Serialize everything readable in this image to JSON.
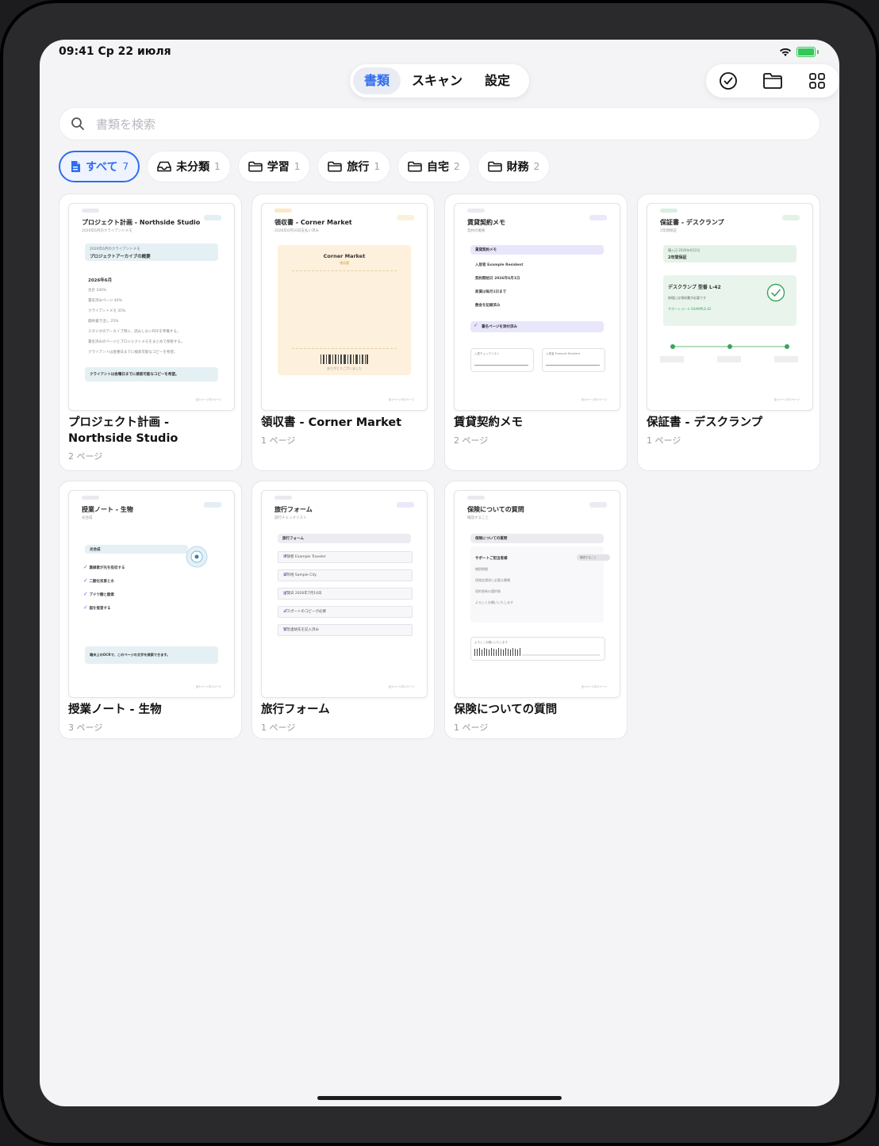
{
  "status_bar": {
    "time": "09:41",
    "date": "Ср 22 июля"
  },
  "segments": [
    {
      "label": "書類",
      "active": true
    },
    {
      "label": "スキャン",
      "active": false
    },
    {
      "label": "設定",
      "active": false
    }
  ],
  "toolbar": {
    "icons": [
      "checkmark-circle-icon",
      "folder-icon",
      "grid-icon"
    ]
  },
  "search": {
    "placeholder": "書類を検索"
  },
  "filters": [
    {
      "label": "すべて",
      "count": "7",
      "icon": "document-icon",
      "active": true
    },
    {
      "label": "未分類",
      "count": "1",
      "icon": "inbox-tray-icon",
      "active": false
    },
    {
      "label": "学習",
      "count": "1",
      "icon": "folder-icon",
      "active": false
    },
    {
      "label": "旅行",
      "count": "1",
      "icon": "folder-icon",
      "active": false
    },
    {
      "label": "自宅",
      "count": "2",
      "icon": "folder-icon",
      "active": false
    },
    {
      "label": "財務",
      "count": "2",
      "icon": "folder-icon",
      "active": false
    }
  ],
  "documents": [
    {
      "title": "プロジェクト計画 - Northside Studio",
      "pages": "2 ページ",
      "thumb": {
        "title": "プロジェクト計画 - Northside Studio",
        "sub": "2026年6月のクライアントメモ",
        "box_small": "2026年6月のクライアントメモ",
        "box_bold": "プロジェクトアーカイブの概要",
        "heading": "2026年6月",
        "lines": [
          "合計 100%",
          "署名済みページ 40%",
          "クライアントメモ 35%",
          "最終書き出し 25%",
          "スタジオのアーカイブ用に、読みしないPDFを準備する。",
          "署名済みのページとプロジェクトメモをまとめて保管する。",
          "クライアントは金曜日までに検索可能なコピーを希望。"
        ],
        "bottom_box": "クライアントは金曜日までに検索可能なコピーを希望。",
        "foot": "全2ページ中1ページ"
      }
    },
    {
      "title": "領収書 - Corner Market",
      "pages": "1 ページ",
      "thumb": {
        "title": "領収書 - Corner Market",
        "sub": "2026年6月10日支払い済み",
        "receipt_name": "Corner Market",
        "receipt_sub": "領収書",
        "receipt_thanks": "ありがとうございました",
        "foot": "全1ページ中1ページ"
      }
    },
    {
      "title": "賃貸契約メモ",
      "pages": "2 ページ",
      "thumb": {
        "title": "賃貸契約メモ",
        "sub": "契約の概要",
        "header_row": "賃貸契約メモ",
        "rows": [
          "入居者 Example Resident",
          "契約開始日 2026年6月1日",
          "家賃は毎月1日まで",
          "敷金を記録済み"
        ],
        "check_row": "署名ページを添付済み",
        "sig_left": "入居チェックリスト",
        "sig_right": "入居者 Example Resident",
        "foot": "全2ページ中1ページ"
      }
    },
    {
      "title": "保証書 - デスクランプ",
      "pages": "1 ページ",
      "thumb": {
        "title": "保証書 - デスクランプ",
        "sub": "2年間保証",
        "box_small": "購入日 2026年6月2日",
        "box_bold": "2年間保証",
        "card_title": "デスクランプ 型番 L-42",
        "card_line": "修理には領収書が必要です",
        "card_code": "サポートコード EXAMPLE-42",
        "foot": "全1ページ中1ページ"
      }
    },
    {
      "title": "授業ノート - 生物",
      "pages": "3 ページ",
      "thumb": {
        "title": "授業ノート - 生物",
        "sub": "光合成",
        "header_row": "光合成",
        "items": [
          "葉緑素が光を吸収する",
          "二酸化炭素と水",
          "ブドウ糖と酸素",
          "図を復習する"
        ],
        "bottom_box": "端末上のOCRで、このページの文字を検索できます。",
        "foot": "全3ページ中1ページ"
      }
    },
    {
      "title": "旅行フォーム",
      "pages": "1 ページ",
      "thumb": {
        "title": "旅行フォーム",
        "sub": "旅行チェックリスト",
        "header_row": "旅行フォーム",
        "rows": [
          "申請者 Example Traveler",
          "目的地 Sample City",
          "出発日 2026年7月14日",
          "パスポートのコピーが必要",
          "緊急連絡先を記入済み"
        ],
        "foot": "全1ページ中1ページ"
      }
    },
    {
      "title": "保険についての質問",
      "pages": "1 ページ",
      "thumb": {
        "title": "保険についての質問",
        "sub": "確認すること",
        "header_row": "保険についての質問",
        "section": "サポートご担当者様",
        "pill": "確認すること",
        "lines": [
          "補償期間",
          "保険金請求に必要な書類",
          "契約更新の選択肢",
          "よろしくお願いいたします"
        ],
        "sig_label": "よろしくお願いいたします",
        "foot": "全1ページ中1ページ"
      }
    }
  ]
}
